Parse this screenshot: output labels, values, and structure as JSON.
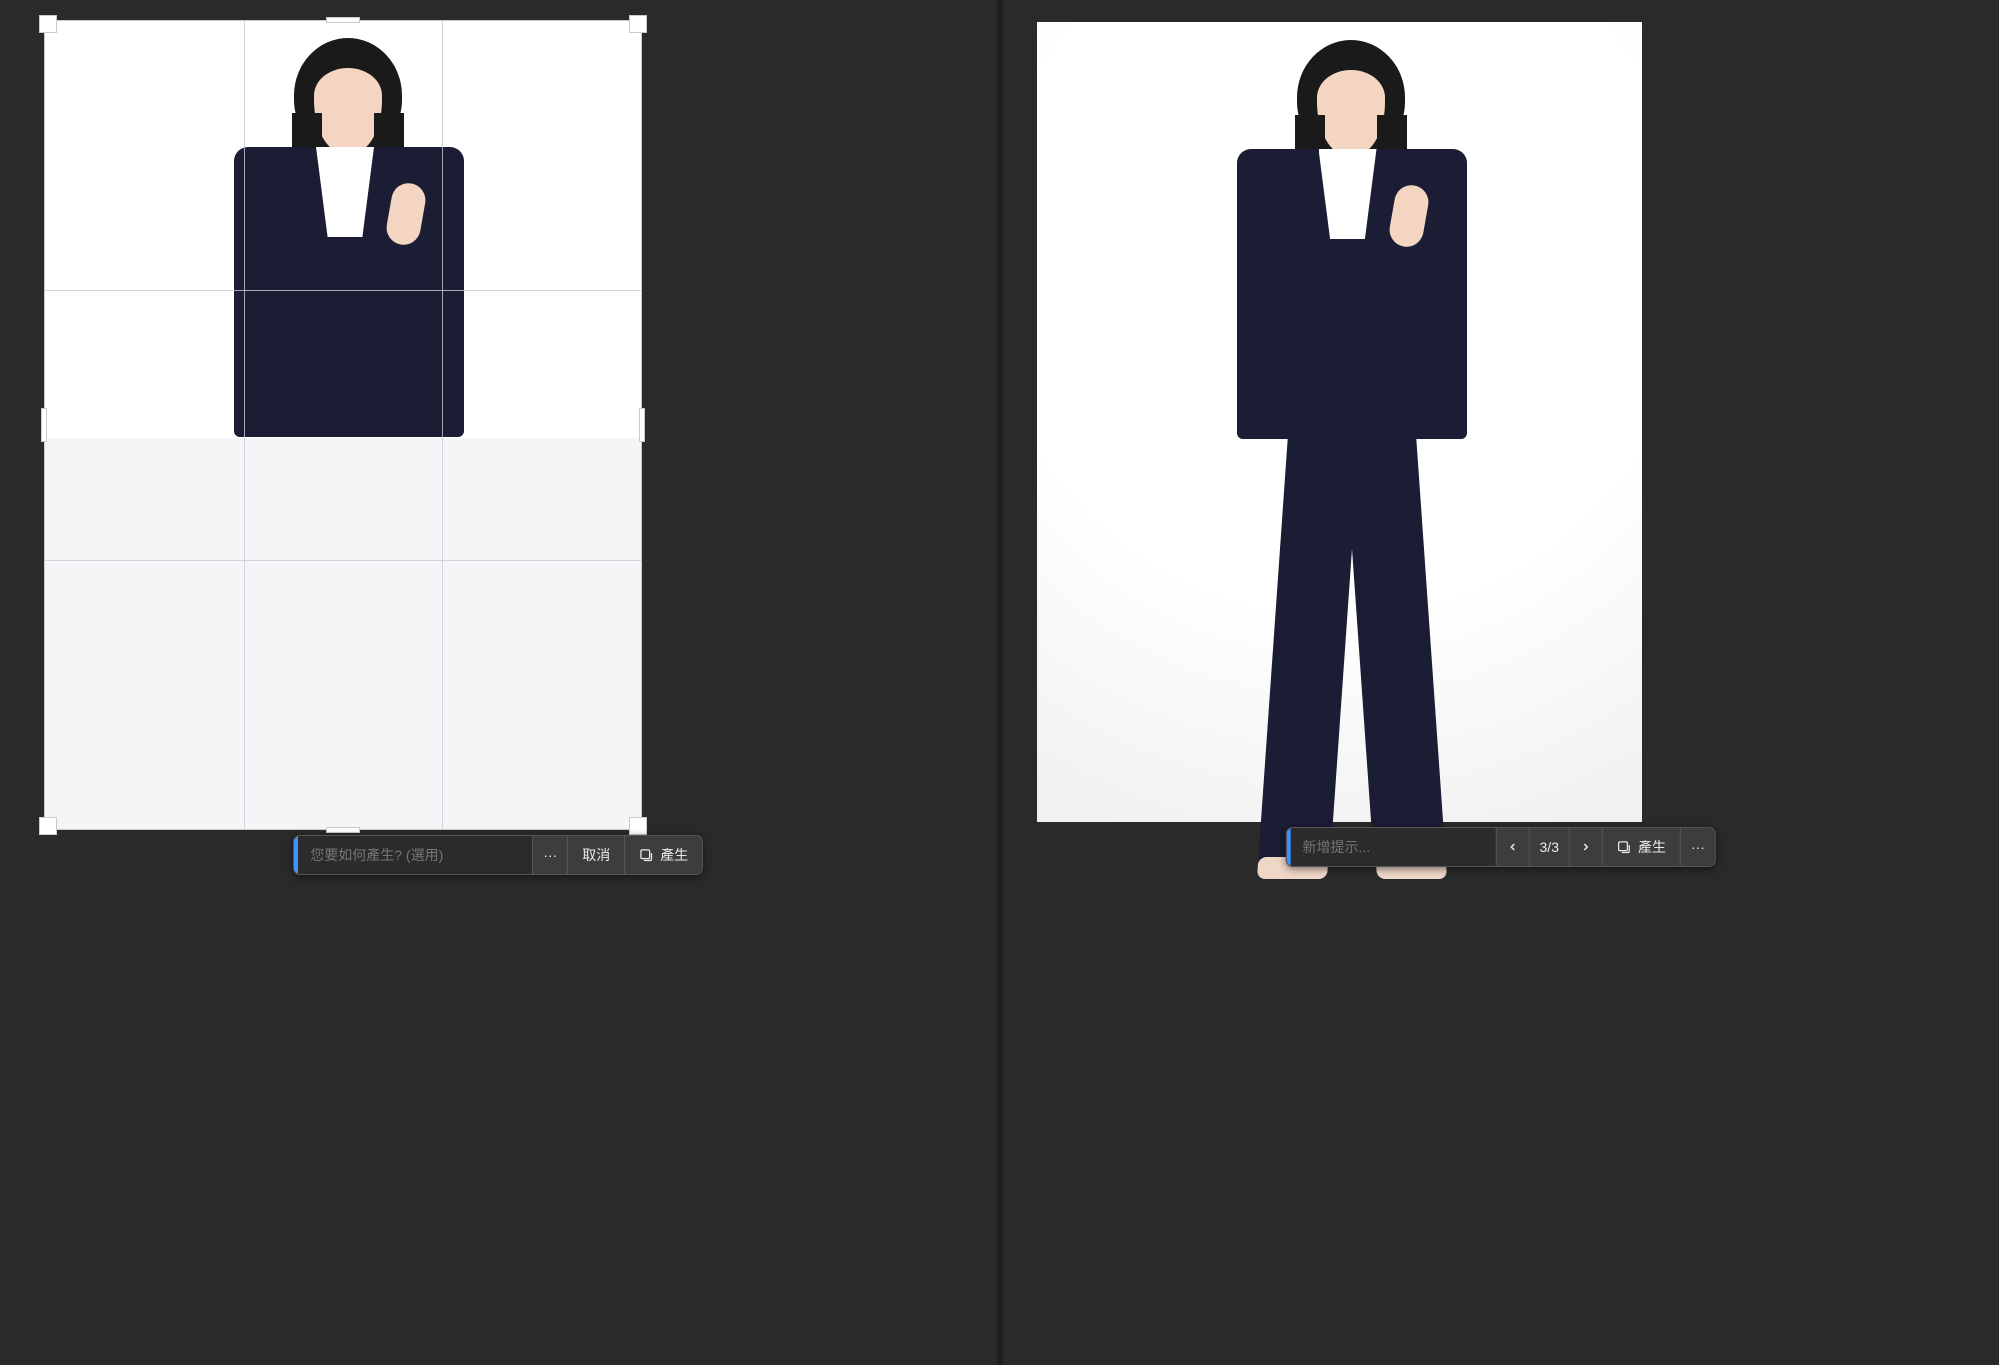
{
  "left": {
    "prompt_placeholder": "您要如何產生? (選用)",
    "more_label": "···",
    "cancel_label": "取消",
    "generate_label": "產生"
  },
  "right": {
    "prompt_placeholder": "新增提示...",
    "counter": "3/3",
    "generate_label": "產生",
    "more_label": "···"
  },
  "icons": {
    "generate": "generate-fill-icon",
    "chevron_left": "chevron-left-icon",
    "chevron_right": "chevron-right-icon",
    "more": "more-icon"
  },
  "colors": {
    "accent": "#3a93ff",
    "panel": "#2a2a2a",
    "toolbar": "#3a3a3a",
    "suit": "#1a1d33"
  }
}
